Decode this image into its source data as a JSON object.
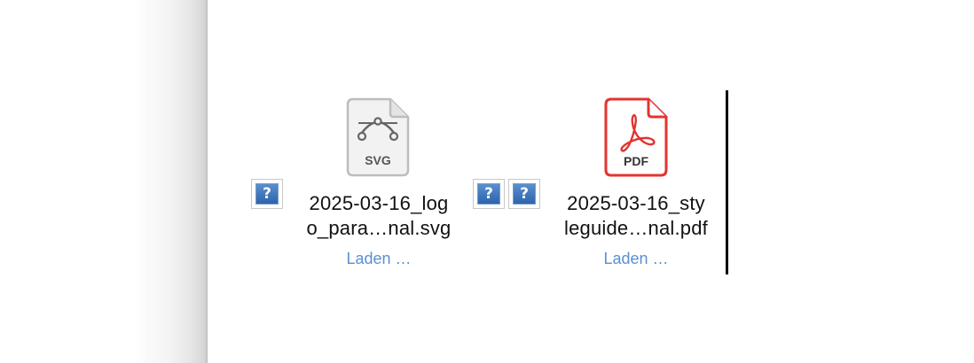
{
  "attachments": [
    {
      "type_label": "SVG",
      "name_line1": "2025-03-16_log",
      "name_line2": "o_para…nal.svg",
      "status": "Laden …",
      "icon": "svg-file-icon",
      "accent": "#8a8a8a"
    },
    {
      "type_label": "PDF",
      "name_line1": "2025-03-16_sty",
      "name_line2": "leguide…nal.pdf",
      "status": "Laden …",
      "icon": "pdf-file-icon",
      "accent": "#e3342f"
    }
  ],
  "broken_image_glyph": "?",
  "icons": [
    "broken-image-icon",
    "svg-file-icon",
    "pdf-file-icon"
  ]
}
